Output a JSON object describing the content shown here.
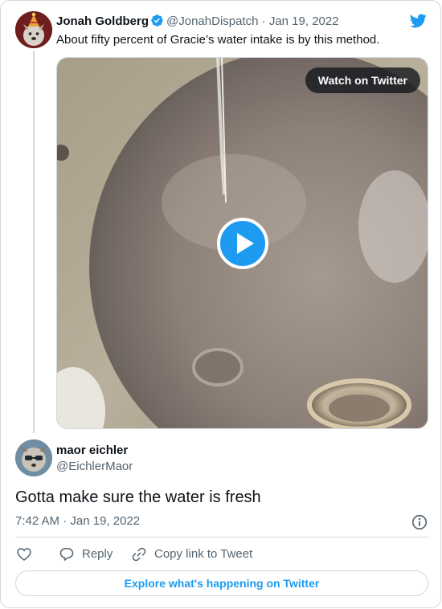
{
  "parent_tweet": {
    "name": "Jonah Goldberg",
    "handle": "@JonahDispatch",
    "separator": "·",
    "date": "Jan 19, 2022",
    "text": "About fifty percent of Gracie’s water intake is by this method.",
    "watch_label": "Watch on Twitter"
  },
  "reply_tweet": {
    "name": "maor eichler",
    "handle": "@EichlerMaor",
    "text": "Gotta make sure the water is fresh",
    "time": "7:42 AM",
    "separator": "·",
    "date": "Jan 19, 2022"
  },
  "actions": {
    "reply_label": "Reply",
    "copy_label": "Copy link to Tweet"
  },
  "footer": {
    "explore_label": "Explore what's happening on Twitter"
  },
  "colors": {
    "brand": "#1d9bf0",
    "text_primary": "#0f1419",
    "text_secondary": "#536471",
    "border": "#cfd9de"
  },
  "icons": [
    "verified-badge-icon",
    "twitter-bird-icon",
    "play-icon",
    "info-icon",
    "heart-icon",
    "reply-bubble-icon",
    "link-icon"
  ]
}
